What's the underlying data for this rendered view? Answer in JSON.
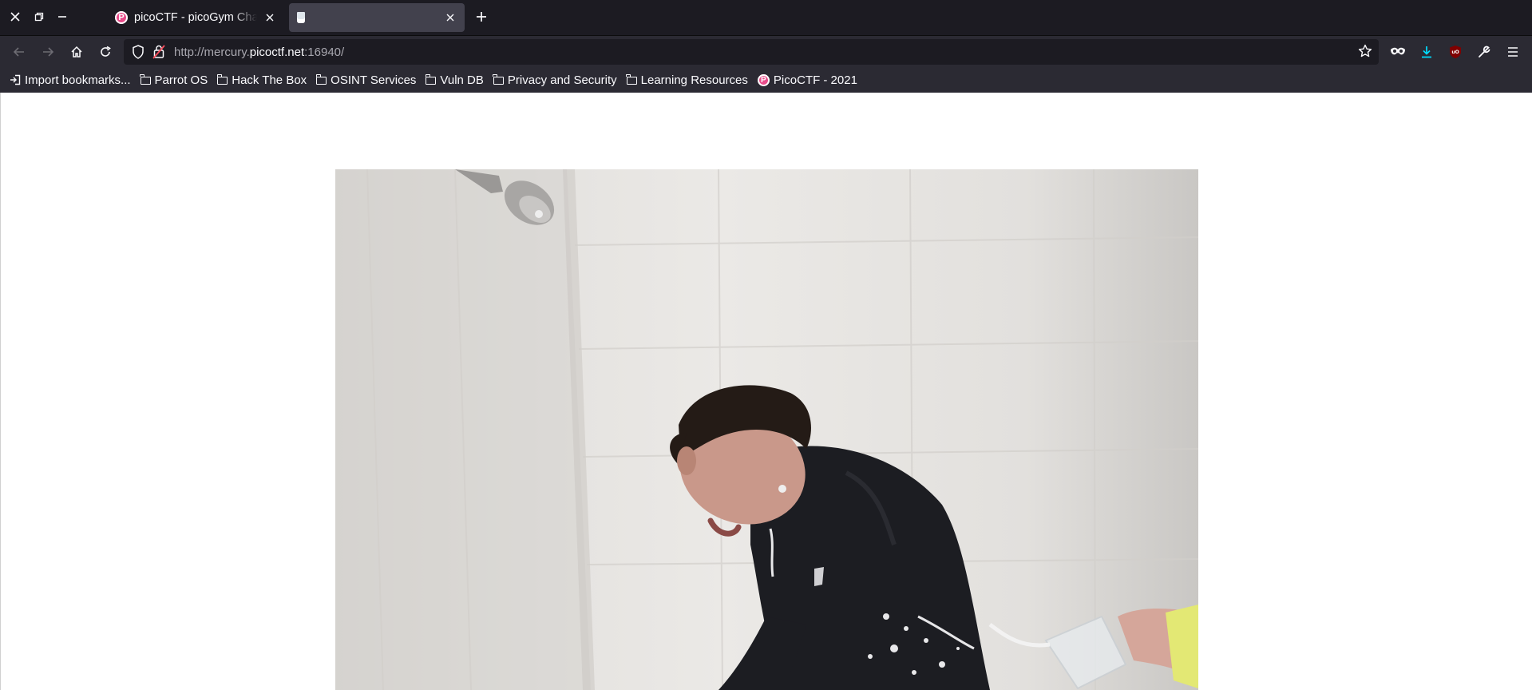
{
  "window_controls": {
    "close_icon": "close-icon",
    "restore_icon": "restore-icon",
    "minimize_icon": "minimize-icon"
  },
  "tabs": [
    {
      "title": "picoCTF - picoGym Challenges",
      "favicon": "picoctf-favicon",
      "active": false
    },
    {
      "title": "",
      "favicon": "milk-glass-favicon",
      "active": true
    }
  ],
  "navigation": {
    "url_prefix": "http://mercury.",
    "url_domain": "picoctf.net",
    "url_suffix": ":16940/"
  },
  "bookmarks": [
    {
      "label": "Import bookmarks...",
      "icon": "import-icon"
    },
    {
      "label": "Parrot OS",
      "icon": "folder-icon"
    },
    {
      "label": "Hack The Box",
      "icon": "folder-icon"
    },
    {
      "label": "OSINT Services",
      "icon": "folder-icon"
    },
    {
      "label": "Vuln DB",
      "icon": "folder-icon"
    },
    {
      "label": "Privacy and Security",
      "icon": "folder-icon"
    },
    {
      "label": "Learning Resources",
      "icon": "folder-icon"
    },
    {
      "label": "PicoCTF - 2021",
      "icon": "picoctf-favicon"
    }
  ],
  "colors": {
    "chrome_dark": "#1c1b22",
    "toolbar": "#2b2a33",
    "active_tab": "#42414d",
    "download_accent": "#00ddff",
    "ublock_red": "#b30000",
    "pico_pink": "#e94b8a"
  }
}
